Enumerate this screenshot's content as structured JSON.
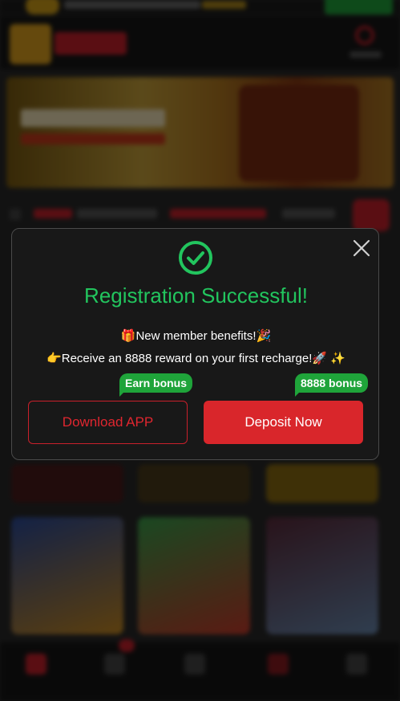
{
  "modal": {
    "title": "Registration Successful!",
    "benefits_line_1": "🎁New member benefits!🎉",
    "benefits_line_2": "👉Receive an 8888 reward on your first recharge!🚀 ✨",
    "download_bubble": "Earn bonus",
    "deposit_bubble": "8888 bonus",
    "download_button": "Download APP",
    "deposit_button": "Deposit Now",
    "icons": {
      "success": "check-circle-icon",
      "close": "close-icon"
    }
  },
  "colors": {
    "success_green": "#22c55e",
    "bubble_green": "#1fa43a",
    "brand_red": "#d9262b",
    "modal_bg": "#181818"
  }
}
